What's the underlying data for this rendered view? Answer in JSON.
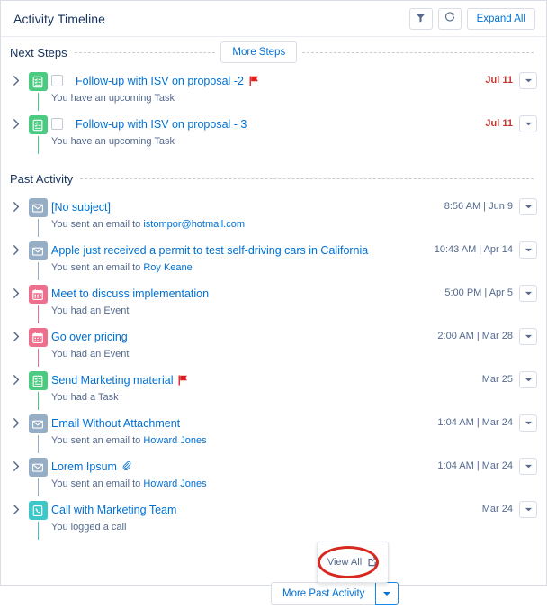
{
  "header": {
    "title": "Activity Timeline",
    "filter_icon": "filter-icon",
    "refresh_icon": "refresh-icon",
    "expand_all_label": "Expand All"
  },
  "sections": [
    {
      "id": "next-steps",
      "label": "Next Steps",
      "more_button_label": "More Steps",
      "items": [
        {
          "type": "task",
          "icon": "task-icon",
          "icon_color": "#4bca81",
          "has_checkbox": true,
          "subject": "Follow-up with ISV on proposal -2",
          "flag": true,
          "attachment": false,
          "description_prefix": "You have an upcoming Task",
          "description_link": "",
          "date": "Jul 11",
          "date_overdue": true
        },
        {
          "type": "task",
          "icon": "task-icon",
          "icon_color": "#4bca81",
          "has_checkbox": true,
          "subject": "Follow-up with ISV on proposal - 3",
          "flag": false,
          "attachment": false,
          "description_prefix": "You have an upcoming Task",
          "description_link": "",
          "date": "Jul 11",
          "date_overdue": true
        }
      ]
    },
    {
      "id": "past-activity",
      "label": "Past Activity",
      "more_button_label": "More Past Activity",
      "items": [
        {
          "type": "email",
          "icon": "email-icon",
          "icon_color": "#95aec5",
          "has_checkbox": false,
          "subject": "[No subject]",
          "flag": false,
          "attachment": false,
          "description_prefix": "You sent an email to ",
          "description_link": "istompor@hotmail.com",
          "date": "8:56 AM | Jun 9",
          "date_overdue": false
        },
        {
          "type": "email",
          "icon": "email-icon",
          "icon_color": "#95aec5",
          "has_checkbox": false,
          "subject": "Apple just received a permit to test self-driving cars in California",
          "flag": false,
          "attachment": false,
          "description_prefix": "You sent an email to ",
          "description_link": "Roy Keane",
          "date": "10:43 AM | Apr 14",
          "date_overdue": false
        },
        {
          "type": "event",
          "icon": "calendar-icon",
          "icon_color": "#ee6e8e",
          "has_checkbox": false,
          "subject": "Meet to discuss implementation",
          "flag": false,
          "attachment": false,
          "description_prefix": "You had an Event",
          "description_link": "",
          "date": "5:00 PM | Apr 5",
          "date_overdue": false
        },
        {
          "type": "event",
          "icon": "calendar-icon",
          "icon_color": "#ee6e8e",
          "has_checkbox": false,
          "subject": "Go over pricing",
          "flag": false,
          "attachment": false,
          "description_prefix": "You had an Event",
          "description_link": "",
          "date": "2:00 AM | Mar 28",
          "date_overdue": false
        },
        {
          "type": "task",
          "icon": "task-icon",
          "icon_color": "#4bca81",
          "has_checkbox": false,
          "subject": "Send Marketing material",
          "flag": true,
          "attachment": false,
          "description_prefix": "You had a Task",
          "description_link": "",
          "date": "Mar 25",
          "date_overdue": false
        },
        {
          "type": "email",
          "icon": "email-icon",
          "icon_color": "#95aec5",
          "has_checkbox": false,
          "subject": "Email Without Attachment",
          "flag": false,
          "attachment": false,
          "description_prefix": "You sent an email to ",
          "description_link": "Howard Jones",
          "date": "1:04 AM | Mar 24",
          "date_overdue": false
        },
        {
          "type": "email",
          "icon": "email-icon",
          "icon_color": "#95aec5",
          "has_checkbox": false,
          "subject": "Lorem Ipsum",
          "flag": false,
          "attachment": true,
          "description_prefix": "You sent an email to ",
          "description_link": "Howard Jones",
          "date": "1:04 AM | Mar 24",
          "date_overdue": false
        },
        {
          "type": "call",
          "icon": "phone-icon",
          "icon_color": "#3cc8c8",
          "has_checkbox": false,
          "subject": "Call with Marketing Team",
          "flag": false,
          "attachment": false,
          "description_prefix": "You logged a call",
          "description_link": "",
          "date": "Mar 24",
          "date_overdue": false
        }
      ]
    }
  ],
  "popover": {
    "view_all_label": "View All",
    "open_new_window_icon": "external-link-icon",
    "annotation_color": "#d6291f"
  },
  "colors": {
    "link": "#0070d2",
    "text": "#16325c",
    "muted": "#54698d",
    "overdue": "#c23934",
    "flag": "#e02020",
    "task": "#4bca81",
    "email": "#95aec5",
    "event": "#ee6e8e",
    "call": "#3cc8c8"
  }
}
